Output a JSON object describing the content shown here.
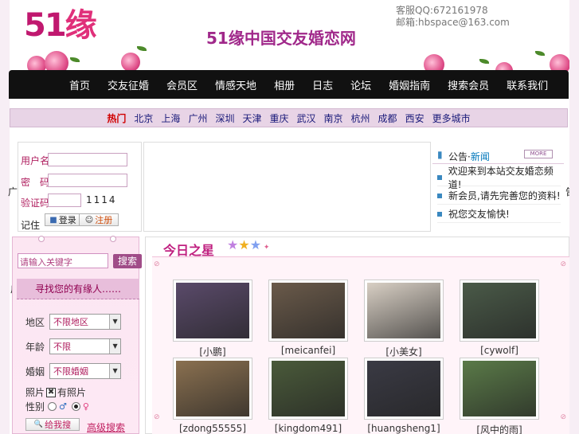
{
  "header": {
    "logo_text": "51",
    "logo_char": "缘",
    "site_title": "51缘中国交友婚恋网",
    "contact": {
      "qq_label": "客服",
      "qq": "QQ:672161978",
      "email_label": "邮箱:",
      "email": "hbspace@163.com"
    }
  },
  "nav": [
    "首页",
    "交友征婚",
    "会员区",
    "情感天地",
    "相册",
    "日志",
    "论坛",
    "婚姻指南",
    "搜索会员",
    "联系我们"
  ],
  "subnav": {
    "hot": "热门",
    "items": [
      "北京",
      "上海",
      "广州",
      "深圳",
      "天津",
      "重庆",
      "武汉",
      "南京",
      "杭州",
      "成都",
      "西安",
      "更多城市"
    ]
  },
  "login": {
    "user_label": "用户名",
    "pass_label": "密　码",
    "code_label": "验证码",
    "captcha": "1114",
    "remember": "记住",
    "login_btn": "登录",
    "register_btn": "注册"
  },
  "news": {
    "title_prefix": "公告·",
    "title_link": "新闻",
    "more": "MORE",
    "items": [
      "欢迎来到本站交友婚恋频道!",
      "新会员,请先完善您的资料!",
      "祝您交友愉快!"
    ]
  },
  "search": {
    "placeholder": "请输入关键字",
    "button": "搜索",
    "title": "寻找您的有缘人……",
    "fields": [
      {
        "label": "地区",
        "value": "不限地区"
      },
      {
        "label": "年龄",
        "value": "不限"
      },
      {
        "label": "婚姻",
        "value": "不限婚姻"
      }
    ],
    "photo_label": "照片",
    "photo_value": "有照片",
    "gender_label": "性别",
    "go_button": "给我搜",
    "advanced": "高级搜索"
  },
  "stars": {
    "title": "今日之星",
    "members": [
      {
        "name": "[小鹏]",
        "color": "#5a4a6a"
      },
      {
        "name": "[meicanfei]",
        "color": "#6a5a4a"
      },
      {
        "name": "[小美女]",
        "color": "#d8cfc4"
      },
      {
        "name": "[cywolf]",
        "color": "#4a5a48"
      },
      {
        "name": "[zdong55555]",
        "color": "#8a7050"
      },
      {
        "name": "[kingdom491]",
        "color": "#4a5a3a"
      },
      {
        "name": "[huangsheng1]",
        "color": "#3a3a44"
      },
      {
        "name": "[风中的雨]",
        "color": "#5a7a48"
      }
    ]
  },
  "side": {
    "left_glyph": "广",
    "right_glyph": "告"
  },
  "colors": {
    "accent": "#c0186f",
    "nav_bg": "#111111",
    "panel_bg": "#fce6f2"
  }
}
